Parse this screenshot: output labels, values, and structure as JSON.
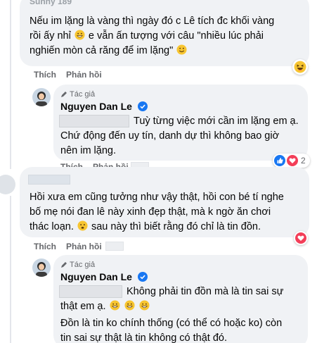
{
  "comment1": {
    "name_partial": "Sunny 189",
    "lines": [
      "Nếu im lặng là vàng thì ngày đó c Lê tích đc khối vàng",
      "rồi ấy nhỉ",
      "e vẫn ấn tượng với câu \"nhiều lúc phải",
      "nghiến mòn cả răng để im lặng\""
    ],
    "actions": {
      "like": "Thích",
      "reply": "Phản hồi"
    }
  },
  "reply1": {
    "author_badge": "Tác giả",
    "name": "Nguyen Dan Le",
    "lines": [
      "Tuỳ từng việc mới cần im lặng em ạ.",
      "Chứ động đến uy tín, danh dự thì không bao giờ",
      "nên im lặng."
    ],
    "actions": {
      "like": "Thích",
      "reply": "Phản hồi"
    },
    "reaction_count": "2"
  },
  "comment2": {
    "lines": [
      "Hồi xưa em cũng tưởng như vậy thật, hồi con bé tí nghe",
      "bố mẹ nói đan lê này xinh đẹp thật, mà k ngờ ăn chơi",
      "thác loạn.",
      "sau này thì biết rằng đó chỉ là tin đồn."
    ],
    "actions": {
      "like": "Thích",
      "reply": "Phản hồi"
    }
  },
  "reply2": {
    "author_badge": "Tác giả",
    "name": "Nguyen Dan Le",
    "lines": [
      "Không phải tin đồn mà là tin sai sự",
      "thật em ạ.",
      "Đồn là tin ko chính thống (có thể có hoặc ko) còn",
      "tin sai sự thật là tin không có thật đó."
    ]
  },
  "colors": {
    "bubble": "#f0f2f5",
    "secondary_text": "#65676b",
    "verified_blue": "#1877f2",
    "love_red": "#f33e58"
  }
}
